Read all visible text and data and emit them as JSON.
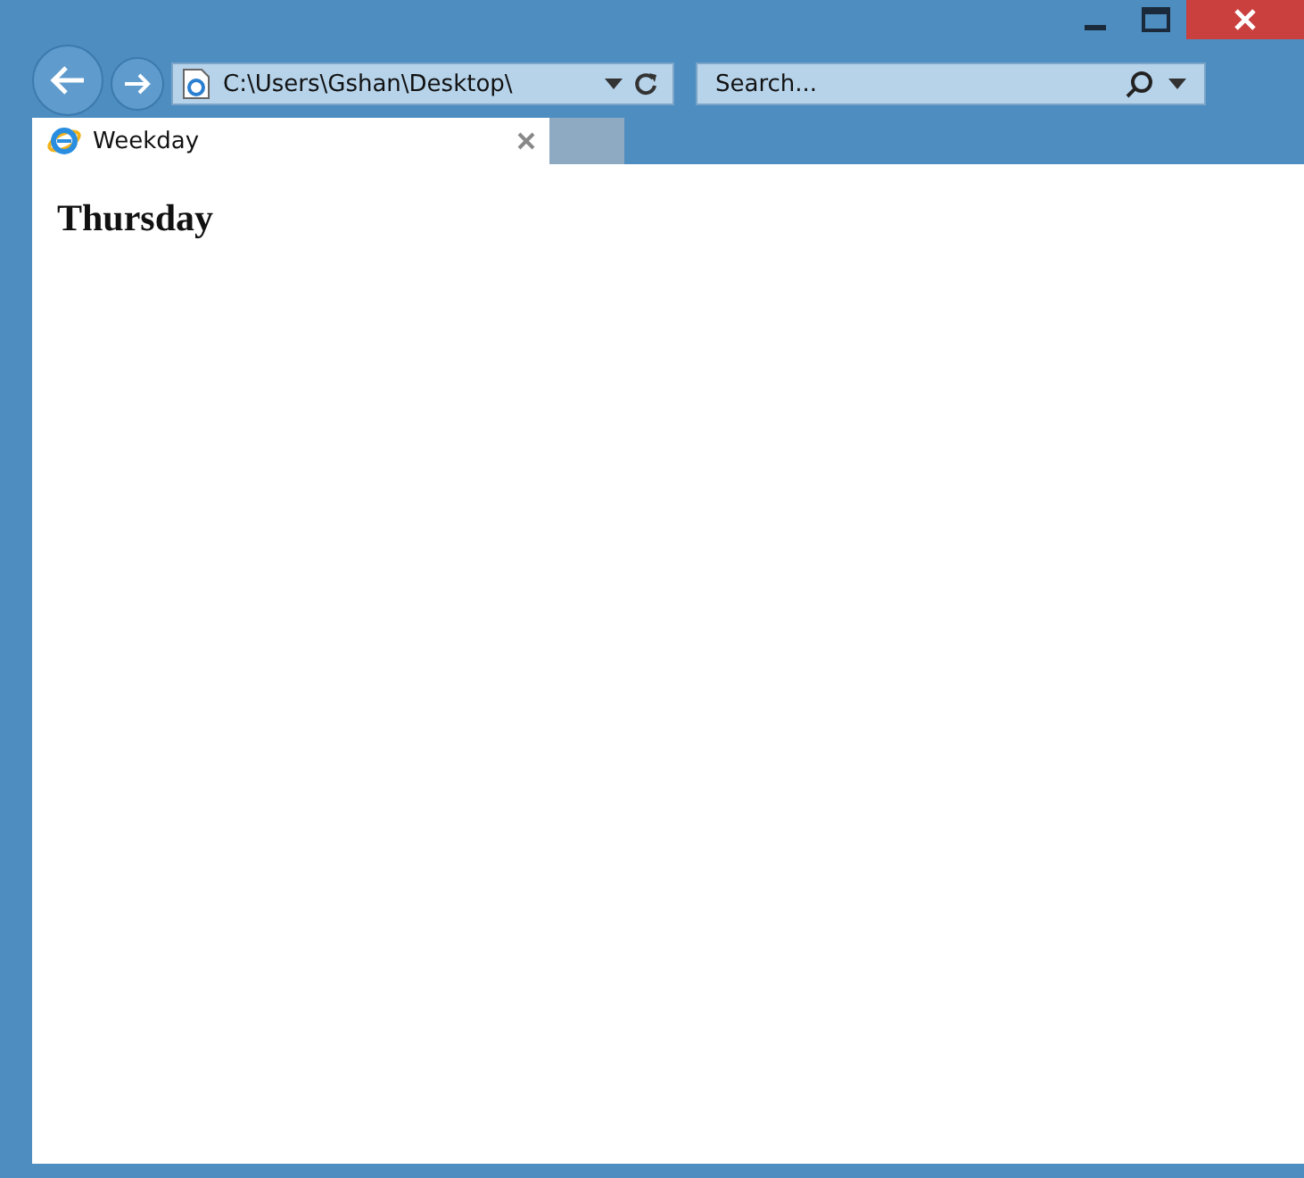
{
  "address_bar": {
    "value": "C:\\Users\\Gshan\\Desktop\\"
  },
  "search": {
    "placeholder": "Search..."
  },
  "tabs": [
    {
      "label": "Weekday",
      "selected": true
    }
  ],
  "page": {
    "heading": "Thursday"
  }
}
